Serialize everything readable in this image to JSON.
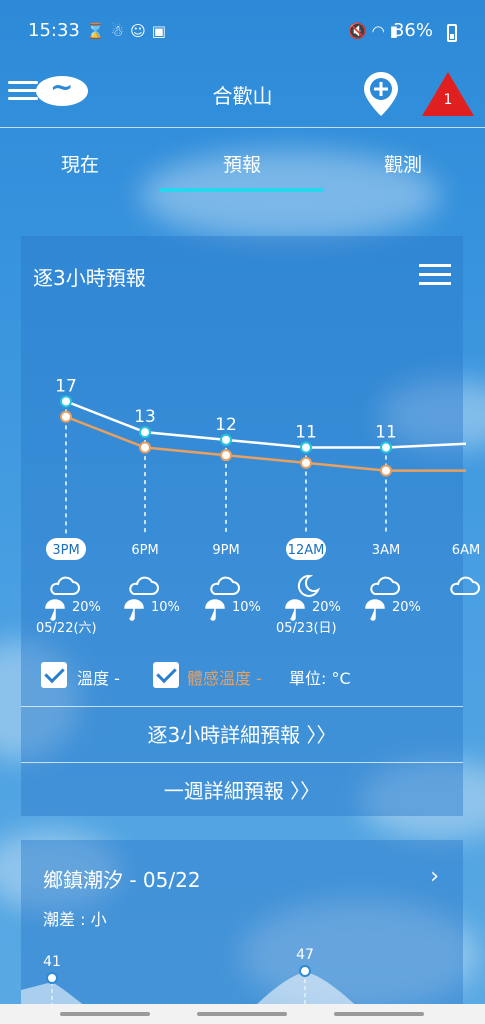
{
  "status_bar": {
    "time": "15:33",
    "battery": "36%",
    "left_icons": [
      "hourglass-icon",
      "person-icon",
      "account-icon",
      "image-icon"
    ],
    "right_icons": [
      "mute-icon",
      "wifi-icon",
      "signal-icon"
    ]
  },
  "header": {
    "location": "合歡山",
    "warning_count": "1",
    "warning_color": "#e02020"
  },
  "tabs": [
    {
      "label": "現在"
    },
    {
      "label": "預報",
      "active": true
    },
    {
      "label": "觀測"
    }
  ],
  "forecast_card": {
    "title": "逐3小時預報",
    "legend": {
      "temp_label": "溫度 -",
      "feel_label": "體感溫度 -",
      "unit_label": "單位: °C"
    },
    "link_hourly": "逐3小時詳細預報 〉〉",
    "link_week": "一週詳細預報 〉〉"
  },
  "chart_data": {
    "type": "line",
    "x": [
      "3PM",
      "6PM",
      "9PM",
      "12AM",
      "3AM",
      "6AM"
    ],
    "selected_x": [
      "3PM",
      "12AM"
    ],
    "series": [
      {
        "name": "溫度",
        "values": [
          17,
          13,
          12,
          11,
          11,
          11.5
        ],
        "color": "#ffffff",
        "labels": [
          "17",
          "13",
          "12",
          "11",
          "11",
          null
        ]
      },
      {
        "name": "體感溫度",
        "values": [
          15,
          11,
          10,
          9,
          8,
          8
        ],
        "color": "#e8a060"
      }
    ],
    "weather_icons": [
      "partly-cloudy-sun-icon",
      "cloudy-moon-icon",
      "cloudy-moon-icon",
      "moon-icon",
      "cloudy-moon-icon",
      "cloudy-icon"
    ],
    "rain_prob": [
      "20%",
      "10%",
      "10%",
      "20%",
      "20%",
      ""
    ],
    "dates": [
      {
        "index": 0,
        "label": "05/22(六)"
      },
      {
        "index": 3,
        "label": "05/23(日)"
      }
    ]
  },
  "tide_card": {
    "title": "鄉鎮潮汐 - 05/22",
    "subtitle": "潮差 : 小",
    "chevron": "›",
    "peaks": [
      "41",
      "47"
    ]
  }
}
